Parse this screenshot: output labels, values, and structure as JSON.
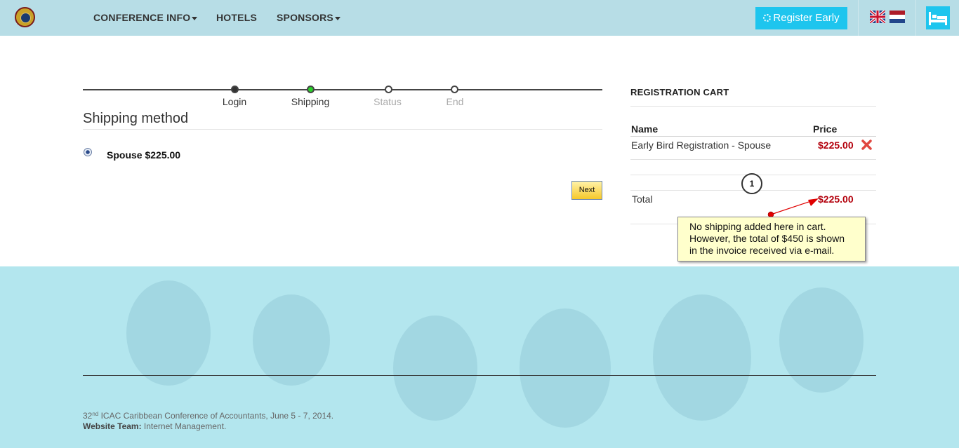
{
  "nav": {
    "items": [
      {
        "label": "CONFERENCE INFO",
        "has_caret": true
      },
      {
        "label": "HOTELS",
        "has_caret": false
      },
      {
        "label": "SPONSORS",
        "has_caret": true
      }
    ],
    "register_label": "Register Early",
    "accent_color": "#1ec5ee",
    "bar_color": "#b7dde6",
    "languages": [
      "english-flag-icon",
      "dutch-flag-icon"
    ]
  },
  "steps": [
    {
      "label": "Login",
      "state": "done"
    },
    {
      "label": "Shipping",
      "state": "active"
    },
    {
      "label": "Status",
      "state": "pending"
    },
    {
      "label": "End",
      "state": "pending"
    }
  ],
  "shipping": {
    "title": "Shipping method",
    "option_label": "Spouse $225.00",
    "next_label": "Next"
  },
  "cart": {
    "title": "REGISTRATION CART",
    "col_name": "Name",
    "col_price": "Price",
    "items": [
      {
        "name": "Early Bird Registration - Spouse",
        "price": "$225.00"
      }
    ],
    "total_label": "Total",
    "total_value": "$225.00",
    "price_color": "#b3000c"
  },
  "annotation": {
    "number": "1",
    "lines": [
      "No shipping added here in cart.",
      "However, the total of $450 is shown",
      "in the invoice received via e-mail."
    ]
  },
  "footer": {
    "ordinal": "32",
    "ordinal_suffix": "nd",
    "conference_text": " ICAC Caribbean Conference of Accountants, June 5 - 7, 2014.",
    "team_label": "Website Team:",
    "team_value": " Internet Management."
  }
}
